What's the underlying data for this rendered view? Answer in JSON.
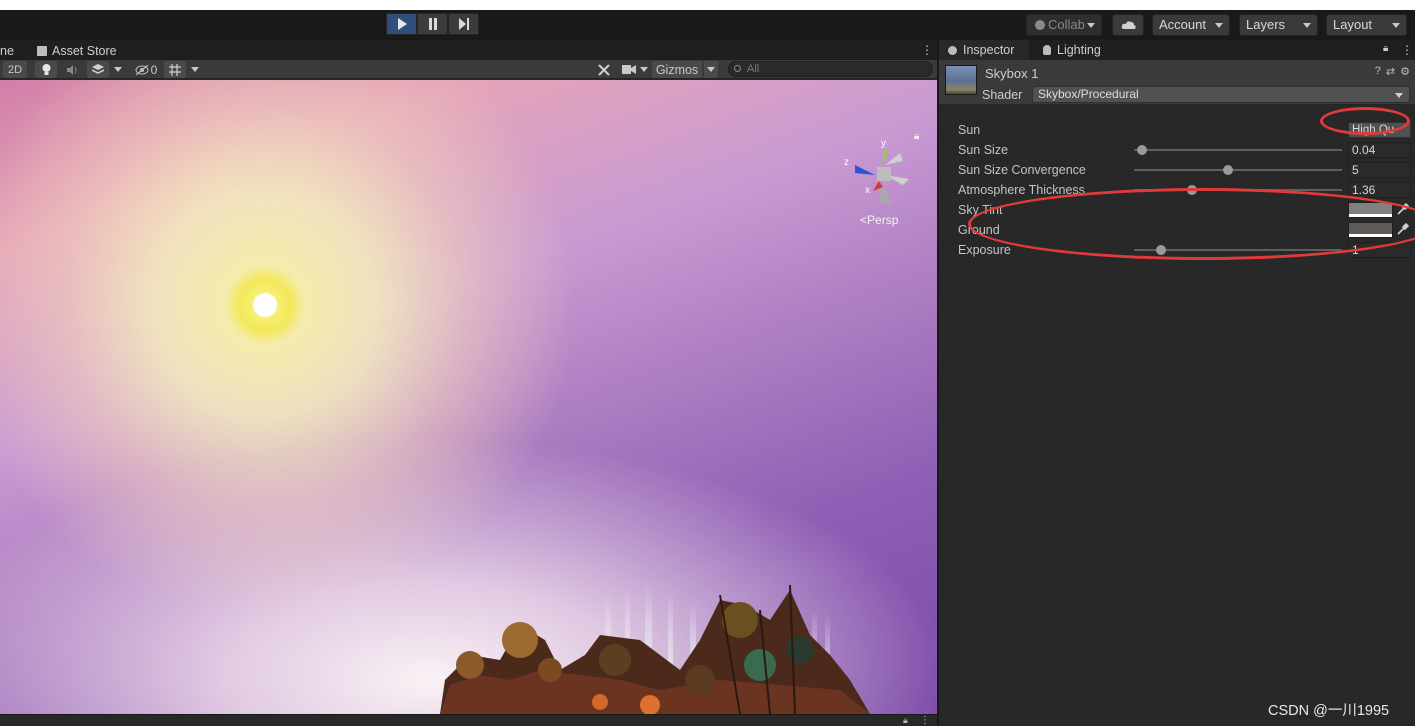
{
  "toolbar": {
    "play_icon": "play-icon",
    "pause_icon": "pause-icon",
    "step_icon": "step-icon",
    "collab_label": "Collab",
    "cloud_icon": "cloud-icon",
    "account_label": "Account",
    "layers_label": "Layers",
    "layout_label": "Layout"
  },
  "scene": {
    "tab_scene_partial": "ne",
    "tab_asset_store": "Asset Store",
    "btn_2d": "2D",
    "hidden_count": "0",
    "gizmos_label": "Gizmos",
    "search_placeholder": "All",
    "persp_label": "Persp",
    "axis_y": "y",
    "axis_z": "z",
    "axis_x": "x"
  },
  "inspector": {
    "tab_inspector": "Inspector",
    "tab_lighting": "Lighting",
    "material_name": "Skybox 1",
    "shader_label": "Shader",
    "shader_value": "Skybox/Procedural",
    "properties": [
      {
        "label": "Sun",
        "value": "High Qu"
      },
      {
        "label": "Sun Size",
        "value": "0.04",
        "slider": 0.04
      },
      {
        "label": "Sun Size Convergence",
        "value": "5",
        "slider": 0.45
      },
      {
        "label": "Atmosphere Thickness",
        "value": "1.36",
        "slider": 0.28
      },
      {
        "label": "Sky Tint",
        "color": "#808080"
      },
      {
        "label": "Ground",
        "color": "#5e5a57"
      },
      {
        "label": "Exposure",
        "value": "1",
        "slider": 0.13
      }
    ]
  },
  "watermark": "CSDN @一川1995",
  "colors": {
    "annotation_red": "#e03b3b",
    "play_active": "#2f4f7a"
  }
}
